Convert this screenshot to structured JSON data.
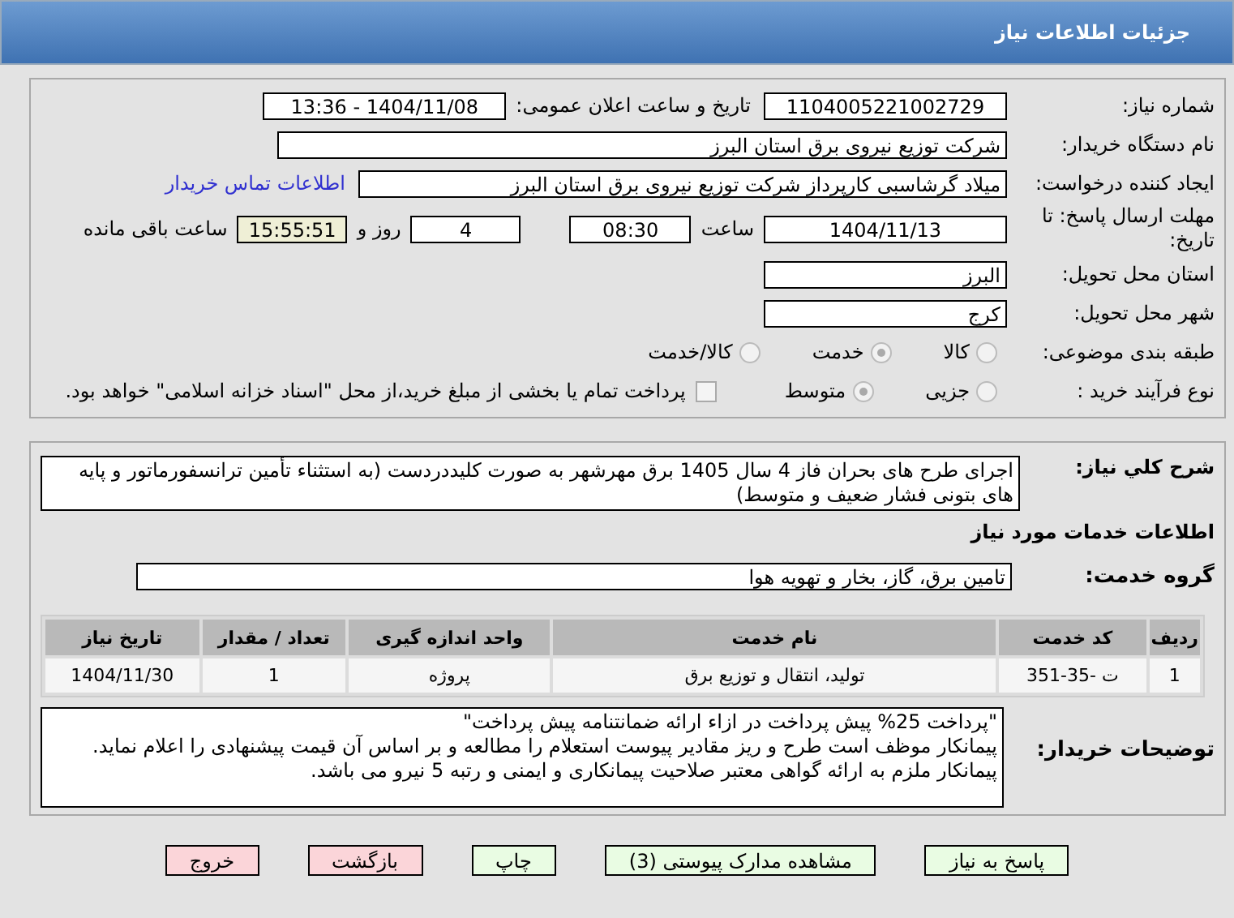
{
  "header": {
    "title": "جزئیات اطلاعات نیاز"
  },
  "need_number": {
    "label": "شماره نیاز:",
    "value": "1104005221002729"
  },
  "announce": {
    "label": "تاریخ و ساعت اعلان عمومی:",
    "value": "1404/11/08 - 13:36"
  },
  "buyer": {
    "label": "نام دستگاه خریدار:",
    "value": "شرکت توزیع نیروی برق استان البرز"
  },
  "creator": {
    "label": "ایجاد کننده درخواست:",
    "value": "میلاد گرشاسبی کارپرداز شرکت توزیع نیروی برق استان البرز",
    "link": "اطلاعات تماس خریدار"
  },
  "deadline": {
    "label": "مهلت ارسال پاسخ: تا تاریخ:",
    "date": "1404/11/13",
    "time_label": "ساعت",
    "time": "08:30",
    "days": "4",
    "days_label": "روز و",
    "remaining": "15:55:51",
    "remaining_label": "ساعت باقی مانده"
  },
  "province": {
    "label": "استان محل تحویل:",
    "value": "البرز"
  },
  "city": {
    "label": "شهر محل تحویل:",
    "value": "کرج"
  },
  "category": {
    "label": "طبقه بندی موضوعی:",
    "options": [
      {
        "label": "کالا",
        "selected": false
      },
      {
        "label": "خدمت",
        "selected": true
      },
      {
        "label": "کالا/خدمت",
        "selected": false
      }
    ]
  },
  "purchase_type": {
    "label": "نوع فرآیند خرید :",
    "options": [
      {
        "label": "جزیی",
        "selected": false
      },
      {
        "label": "متوسط",
        "selected": true
      }
    ],
    "payment": {
      "checked": false,
      "text": "پرداخت تمام یا بخشی از مبلغ خرید،از محل \"اسناد خزانه اسلامی\" خواهد بود."
    }
  },
  "description": {
    "label": "شرح کلي نياز:",
    "value": "اجرای طرح های بحران فاز 4 سال 1405 برق مهرشهر به صورت کلیددردست (به استثناء تأمین ترانسفورماتور و پایه های بتونی فشار ضعیف و متوسط)"
  },
  "services_title": "اطلاعات خدمات مورد نیاز",
  "service_group": {
    "label": "گروه خدمت:",
    "value": "تامین برق، گاز، بخار و تهویه هوا"
  },
  "table": {
    "columns": [
      "ردیف",
      "کد خدمت",
      "نام خدمت",
      "واحد اندازه گیری",
      "تعداد / مقدار",
      "تاریخ نیاز"
    ],
    "rows": [
      [
        "1",
        "ت -35-351",
        "تولید، انتقال و توزیع برق",
        "پروژه",
        "1",
        "1404/11/30"
      ]
    ]
  },
  "notes": {
    "label": "توضیحات خریدار:",
    "lines": [
      "\"پرداخت 25% پیش پرداخت در ازاء ارائه ضمانتنامه پیش پرداخت\"",
      "پیمانکار موظف است طرح و ریز مقادیر پیوست استعلام را مطالعه و بر اساس آن قیمت پیشنهادی را اعلام نماید.",
      "پیمانکار ملزم به ارائه گواهی معتبر صلاحیت پیمانکاری و ایمنی و رتبه 5 نیرو می باشد."
    ]
  },
  "buttons": [
    {
      "label": "پاسخ به نیاز",
      "kind": "go"
    },
    {
      "label": "مشاهده مدارک پیوستی (3)",
      "kind": "go"
    },
    {
      "label": "چاپ",
      "kind": "go"
    },
    {
      "label": "بازگشت",
      "kind": "stop"
    },
    {
      "label": "خروج",
      "kind": "stop"
    }
  ]
}
